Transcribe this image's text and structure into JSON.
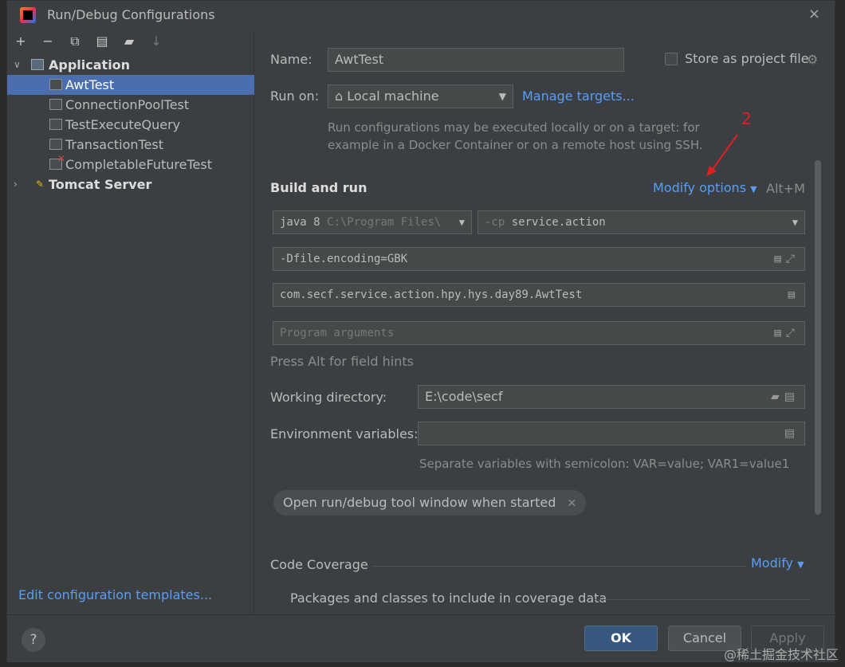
{
  "window": {
    "title": "Run/Debug Configurations",
    "close": "×"
  },
  "toolbar": {
    "add": "+",
    "remove": "−",
    "copy": "⧉",
    "save": "▤",
    "folder": "▰",
    "sort": "↓"
  },
  "tree": {
    "application": "Application",
    "items": [
      "AwtTest",
      "ConnectionPoolTest",
      "TestExecuteQuery",
      "TransactionTest",
      "CompletableFutureTest"
    ],
    "tomcat": "Tomcat Server",
    "expanded_arrow": "∨",
    "collapsed_arrow": "›"
  },
  "edit_templates": "Edit configuration templates...",
  "form": {
    "name_label": "Name:",
    "name_value": "AwtTest",
    "store_label": "Store as project file",
    "run_on_label": "Run on:",
    "run_on_value": "Local machine",
    "manage_targets": "Manage targets...",
    "run_info_1": "Run configurations may be executed locally or on a target: for",
    "run_info_2": "example in a Docker Container or on a remote host using SSH.",
    "build_and_run": "Build and run",
    "modify_options": "Modify options",
    "modify_shortcut": "Alt+M",
    "jdk_value": "java 8",
    "jdk_path": "C:\\Program Files\\",
    "cp_prefix": "-cp",
    "cp_value": "service.action",
    "vm_options": "-Dfile.encoding=GBK",
    "main_class": "com.secf.service.action.hpy.hys.day89.AwtTest",
    "program_args_placeholder": "Program arguments",
    "field_hints": "Press Alt for field hints",
    "working_dir_label": "Working directory:",
    "working_dir_value": "E:\\code\\secf",
    "env_label": "Environment variables:",
    "env_hint": "Separate variables with semicolon: VAR=value; VAR1=value1",
    "open_tool_window": "Open run/debug tool window when started",
    "code_coverage": "Code Coverage",
    "modify": "Modify",
    "packages_classes": "Packages and classes to include in coverage data"
  },
  "annotation": {
    "number": "2"
  },
  "buttons": {
    "help": "?",
    "ok": "OK",
    "cancel": "Cancel",
    "apply": "Apply"
  },
  "watermark": "@稀土掘金技术社区"
}
